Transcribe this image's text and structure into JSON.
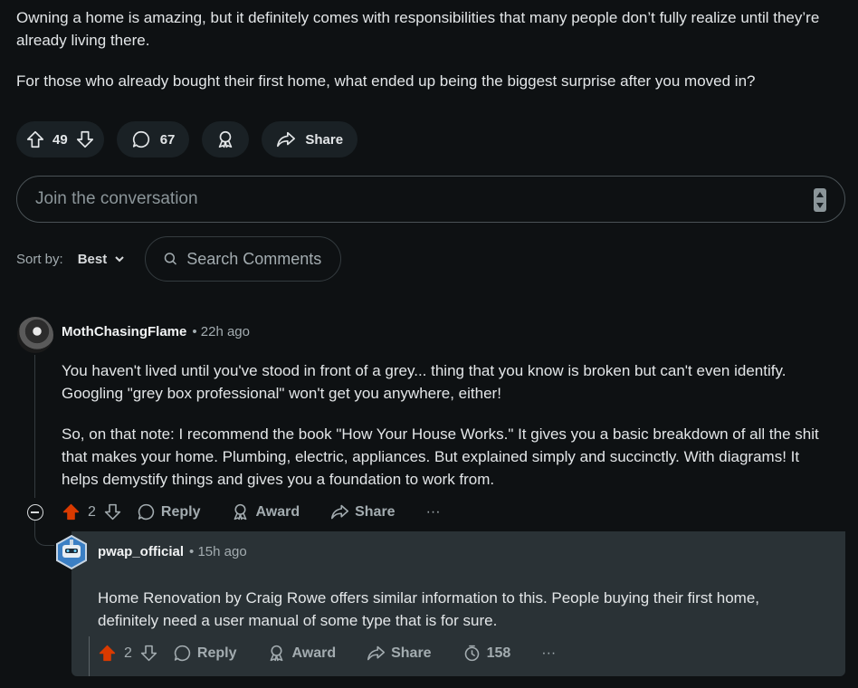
{
  "post": {
    "paragraphs": [
      "Owning a home is amazing, but it definitely comes with responsibilities that many people don’t fully realize until they’re already living there.",
      "For those who already bought their first home, what ended up being the biggest surprise after you moved in?"
    ],
    "votes": "49",
    "comments": "67",
    "share_label": "Share"
  },
  "join": {
    "placeholder": "Join the conversation"
  },
  "sort": {
    "label": "Sort by:",
    "value": "Best"
  },
  "search": {
    "placeholder": "Search Comments"
  },
  "comments": [
    {
      "author": "MothChasingFlame",
      "time": "• 22h ago",
      "paragraphs": [
        "You haven't lived until you've stood in front of a grey... thing that you know is broken but can't even identify. Googling \"grey box professional\" won't get you anywhere, either!",
        "So, on that note: I recommend the book \"How Your House Works.\" It gives you a basic breakdown of all the shit that makes your home. Plumbing, electric, appliances. But explained simply and succinctly. With diagrams! It helps demystify things and gives you a foundation to work from."
      ],
      "votes": "2",
      "reply_label": "Reply",
      "award_label": "Award",
      "share_label": "Share",
      "more_label": "···"
    },
    {
      "author": "pwap_official",
      "time": "• 15h ago",
      "paragraphs": [
        "Home Renovation by Craig Rowe offers similar information to this. People buying their first home, definitely need a user manual of some type that is for sure."
      ],
      "votes": "2",
      "reply_label": "Reply",
      "award_label": "Award",
      "share_label": "Share",
      "views": "158",
      "more_label": "···"
    }
  ],
  "colors": {
    "background": "#0e1113",
    "upvote_active": "#d93a00",
    "reply_panel": "#2a3236"
  },
  "icons": [
    "upvote-icon",
    "downvote-icon",
    "comment-icon",
    "award-icon",
    "share-icon",
    "search-icon",
    "chevron-down-icon",
    "collapse-icon",
    "views-icon",
    "more-icon"
  ]
}
